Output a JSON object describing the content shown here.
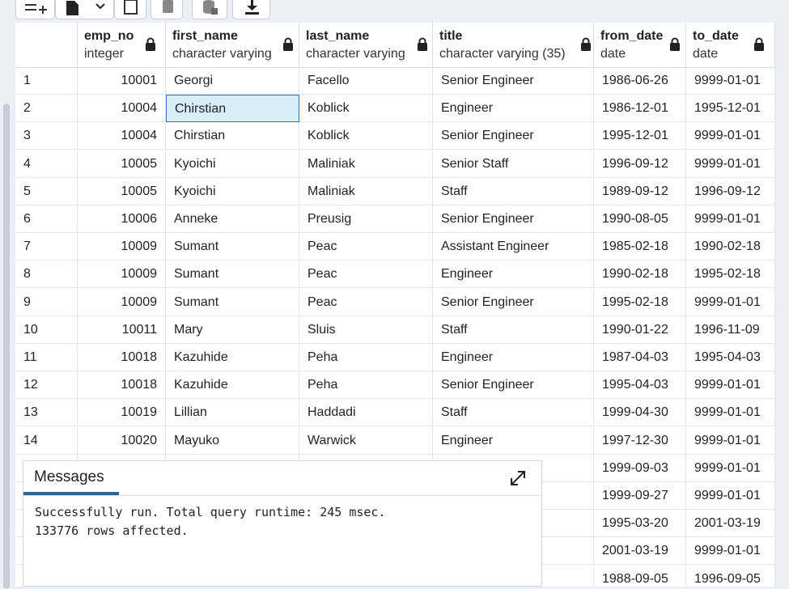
{
  "toolbar": {
    "buttons": [
      {
        "name": "add-row-icon"
      },
      {
        "name": "copy-icon"
      },
      {
        "name": "chevron-down-icon"
      },
      {
        "name": "paste-icon"
      },
      {
        "name": "delete-icon"
      },
      {
        "name": "save-data-icon"
      },
      {
        "name": "download-icon"
      }
    ]
  },
  "grid": {
    "columns": [
      {
        "name": "emp_no",
        "type": "integer"
      },
      {
        "name": "first_name",
        "type": "character varying"
      },
      {
        "name": "last_name",
        "type": "character varying"
      },
      {
        "name": "title",
        "type": "character varying (35)"
      },
      {
        "name": "from_date",
        "type": "date"
      },
      {
        "name": "to_date",
        "type": "date"
      }
    ],
    "rows": [
      [
        "1",
        "10001",
        "Georgi",
        "Facello",
        "Senior Engineer",
        "1986-06-26",
        "9999-01-01"
      ],
      [
        "2",
        "10004",
        "Chirstian",
        "Koblick",
        "Engineer",
        "1986-12-01",
        "1995-12-01"
      ],
      [
        "3",
        "10004",
        "Chirstian",
        "Koblick",
        "Senior Engineer",
        "1995-12-01",
        "9999-01-01"
      ],
      [
        "4",
        "10005",
        "Kyoichi",
        "Maliniak",
        "Senior Staff",
        "1996-09-12",
        "9999-01-01"
      ],
      [
        "5",
        "10005",
        "Kyoichi",
        "Maliniak",
        "Staff",
        "1989-09-12",
        "1996-09-12"
      ],
      [
        "6",
        "10006",
        "Anneke",
        "Preusig",
        "Senior Engineer",
        "1990-08-05",
        "9999-01-01"
      ],
      [
        "7",
        "10009",
        "Sumant",
        "Peac",
        "Assistant Engineer",
        "1985-02-18",
        "1990-02-18"
      ],
      [
        "8",
        "10009",
        "Sumant",
        "Peac",
        "Engineer",
        "1990-02-18",
        "1995-02-18"
      ],
      [
        "9",
        "10009",
        "Sumant",
        "Peac",
        "Senior Engineer",
        "1995-02-18",
        "9999-01-01"
      ],
      [
        "10",
        "10011",
        "Mary",
        "Sluis",
        "Staff",
        "1990-01-22",
        "1996-11-09"
      ],
      [
        "11",
        "10018",
        "Kazuhide",
        "Peha",
        "Engineer",
        "1987-04-03",
        "1995-04-03"
      ],
      [
        "12",
        "10018",
        "Kazuhide",
        "Peha",
        "Senior Engineer",
        "1995-04-03",
        "9999-01-01"
      ],
      [
        "13",
        "10019",
        "Lillian",
        "Haddadi",
        "Staff",
        "1999-04-30",
        "9999-01-01"
      ],
      [
        "14",
        "10020",
        "Mayuko",
        "Warwick",
        "Engineer",
        "1997-12-30",
        "9999-01-01"
      ],
      [
        "",
        "",
        "",
        "",
        "",
        "1999-09-03",
        "9999-01-01"
      ],
      [
        "",
        "",
        "",
        "",
        "",
        "1999-09-27",
        "9999-01-01"
      ],
      [
        "",
        "",
        "",
        "",
        "",
        "1995-03-20",
        "2001-03-19"
      ],
      [
        "",
        "",
        "",
        "",
        "",
        "2001-03-19",
        "9999-01-01"
      ],
      [
        "",
        "",
        "",
        "",
        "",
        "1988-09-05",
        "1996-09-05"
      ]
    ],
    "selected": {
      "row": 1,
      "col": 2
    }
  },
  "messages": {
    "tab_label": "Messages",
    "lines": [
      "Successfully run. Total query runtime: 245 msec.",
      "133776 rows affected."
    ]
  },
  "colors": {
    "selection_bg": "#d9edfa",
    "selection_border": "#2f72c0",
    "tab_underline": "#326690"
  }
}
